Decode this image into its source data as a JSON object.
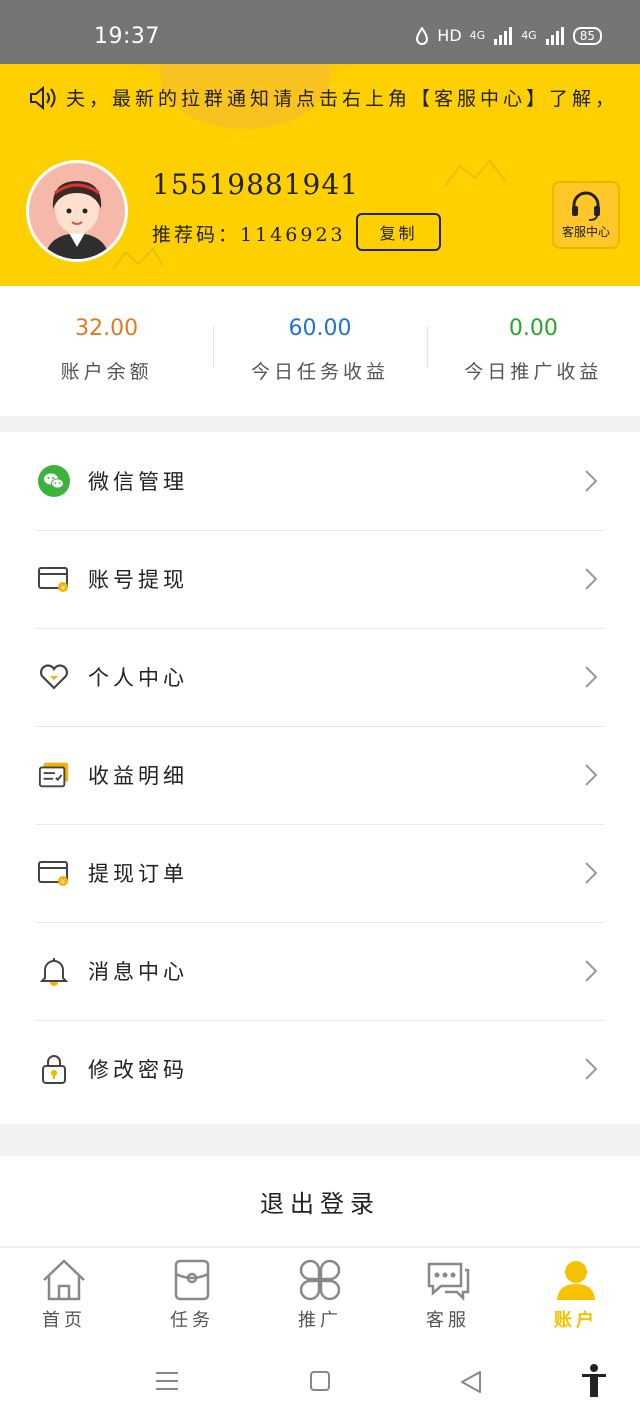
{
  "status_bar": {
    "time": "19:37",
    "network_label": "HD",
    "signal_1": "4G",
    "signal_2": "4G",
    "battery": "85"
  },
  "header": {
    "notice": "夫，最新的拉群通知请点击右上角【客服中心】了解，",
    "phone": "15519881941",
    "ref_code_label": "推荐码：1146923",
    "copy_button": "复制",
    "service_center": "客服中心"
  },
  "stats": [
    {
      "value": "32.00",
      "label": "账户余额",
      "color": "#e07b20"
    },
    {
      "value": "60.00",
      "label": "今日任务收益",
      "color": "#1f73d6"
    },
    {
      "value": "0.00",
      "label": "今日推广收益",
      "color": "#2aa42a"
    }
  ],
  "menu": [
    {
      "label": "微信管理",
      "icon": "wechat-icon"
    },
    {
      "label": "账号提现",
      "icon": "wallet-icon"
    },
    {
      "label": "个人中心",
      "icon": "heart-icon"
    },
    {
      "label": "收益明细",
      "icon": "income-card-icon"
    },
    {
      "label": "提现订单",
      "icon": "wallet-icon"
    },
    {
      "label": "消息中心",
      "icon": "bell-icon"
    },
    {
      "label": "修改密码",
      "icon": "lock-icon"
    }
  ],
  "logout_label": "退出登录",
  "tabs": [
    {
      "label": "首页",
      "icon": "home-icon",
      "active": false
    },
    {
      "label": "任务",
      "icon": "task-icon",
      "active": false
    },
    {
      "label": "推广",
      "icon": "clover-icon",
      "active": false
    },
    {
      "label": "客服",
      "icon": "chat-icon",
      "active": false
    },
    {
      "label": "账户",
      "icon": "user-icon",
      "active": true
    }
  ],
  "colors": {
    "accent": "#ffd000",
    "active_tab": "#f7c300"
  }
}
